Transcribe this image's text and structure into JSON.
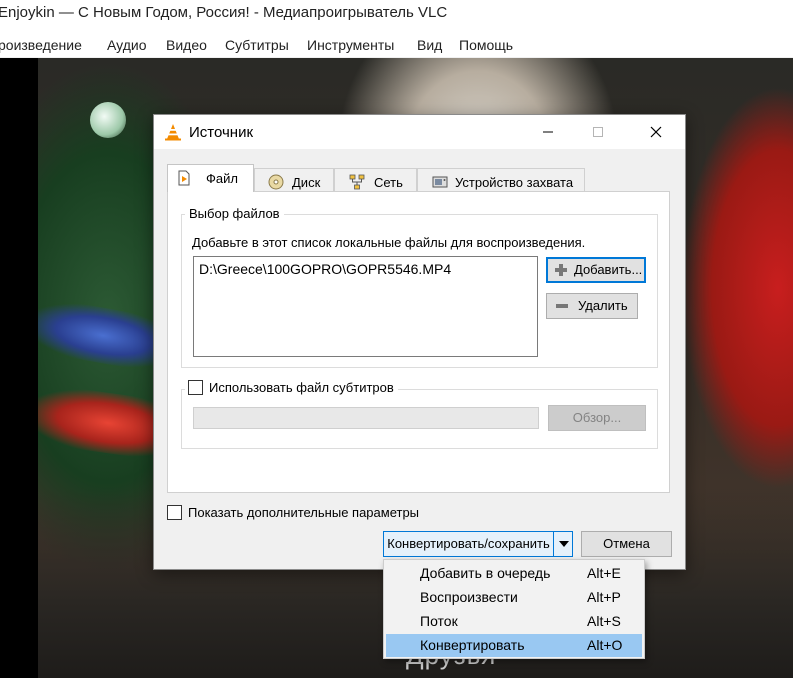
{
  "window": {
    "title": "Enjoykin — С Новым Годом, Россия! - Медиапроигрыватель VLC",
    "menu": [
      "роизведение",
      "Аудио",
      "Видео",
      "Субтитры",
      "Инструменты",
      "Вид",
      "Помощь"
    ]
  },
  "video": {
    "caption": "Друзья"
  },
  "dialog": {
    "title": "Источник",
    "tabs": [
      "Файл",
      "Диск",
      "Сеть",
      "Устройство захвата"
    ],
    "file_selection": {
      "group_title": "Выбор файлов",
      "hint": "Добавьте в этот список локальные файлы для воспроизведения.",
      "files": [
        "D:\\Greece\\100GOPRO\\GOPR5546.MP4"
      ],
      "add_label": "Добавить...",
      "remove_label": "Удалить"
    },
    "subtitles": {
      "checkbox_label": "Использовать файл субтитров",
      "checked": false,
      "browse_label": "Обзор..."
    },
    "show_more": {
      "label": "Показать дополнительные параметры",
      "checked": false
    },
    "primary_label": "Конвертировать/сохранить",
    "cancel_label": "Отмена"
  },
  "menu": {
    "items": [
      {
        "label": "Добавить в очередь",
        "shortcut": "Alt+E",
        "highlighted": false
      },
      {
        "label": "Воспроизвести",
        "shortcut": "Alt+P",
        "highlighted": false
      },
      {
        "label": "Поток",
        "shortcut": "Alt+S",
        "highlighted": false
      },
      {
        "label": "Конвертировать",
        "shortcut": "Alt+O",
        "highlighted": true
      }
    ]
  },
  "colors": {
    "accent": "#0078d7",
    "menu_highlight": "#99c8f2",
    "vlc_orange": "#f38b00"
  }
}
